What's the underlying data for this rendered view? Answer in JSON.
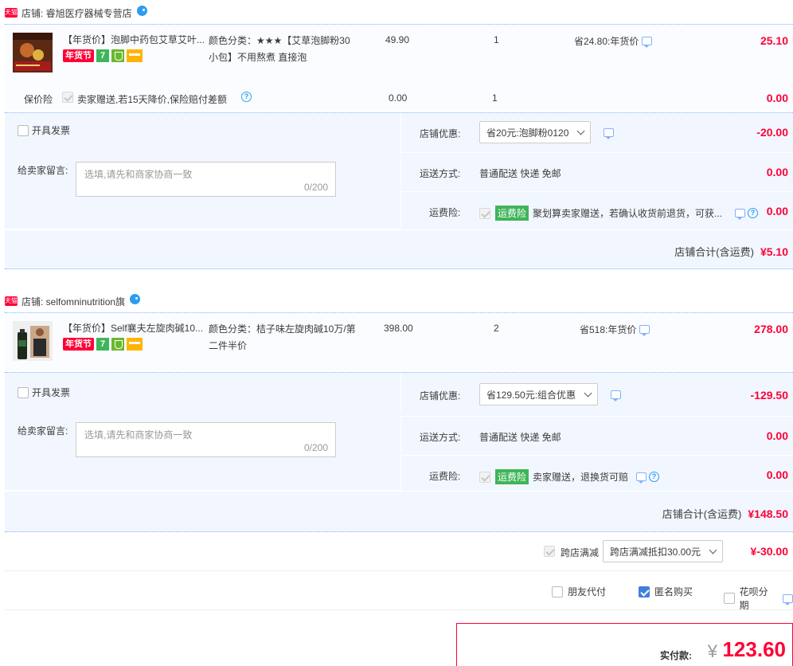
{
  "shops": [
    {
      "tmall_logo": "天猫",
      "name": "店铺: 睿旭医疗器械专营店",
      "item": {
        "title": "【年货价】泡脚中药包艾草艾叶...",
        "badge_festival": "年货节",
        "badge_seven": "7",
        "sku": "颜色分类：★★★【艾草泡脚粉30小包】不用熬煮 直接泡",
        "price": "49.90",
        "qty": "1",
        "promo": "省24.80:年货价",
        "subtotal": "25.10"
      },
      "insurance": {
        "label": "保价险",
        "desc": "卖家赠送,若15天降价,保险赔付差额",
        "price": "0.00",
        "qty": "1",
        "subtotal": "0.00"
      },
      "invoice_label": "开具发票",
      "memo_label": "给卖家留言:",
      "memo_placeholder": "选填,请先和商家协商一致",
      "memo_count": "0/200",
      "discount_label": "店铺优惠:",
      "discount_select": "省20元:泡脚粉0120",
      "discount_amount": "-20.00",
      "ship_label": "运送方式:",
      "ship_value": "普通配送 快递 免邮",
      "ship_amount": "0.00",
      "freight_ins_label": "运费险:",
      "freight_ins_tag": "运费险",
      "freight_ins_desc": "聚划算卖家赠送，若确认收货前退货，可获...",
      "freight_ins_amount": "0.00",
      "total_label": "店铺合计(含运费)",
      "total_amount": "¥5.10"
    },
    {
      "tmall_logo": "天猫",
      "name": "店铺: selfomninutrition旗",
      "item": {
        "title": "【年货价】Self襄夫左旋肉碱10...",
        "badge_festival": "年货节",
        "badge_seven": "7",
        "sku": "颜色分类：桔子味左旋肉碱10万/第二件半价",
        "price": "398.00",
        "qty": "2",
        "promo": "省518:年货价",
        "subtotal": "278.00"
      },
      "invoice_label": "开具发票",
      "memo_label": "给卖家留言:",
      "memo_placeholder": "选填,请先和商家协商一致",
      "memo_count": "0/200",
      "discount_label": "店铺优惠:",
      "discount_select": "省129.50元:组合优惠",
      "discount_amount": "-129.50",
      "ship_label": "运送方式:",
      "ship_value": "普通配送 快递 免邮",
      "ship_amount": "0.00",
      "freight_ins_label": "运费险:",
      "freight_ins_tag": "运费险",
      "freight_ins_desc": "卖家赠送，退换货可赔",
      "freight_ins_amount": "0.00",
      "total_label": "店铺合计(含运费)",
      "total_amount": "¥148.50"
    }
  ],
  "cross_store": {
    "label": "跨店满减",
    "select": "跨店满减抵扣30.00元",
    "amount": "¥-30.00"
  },
  "pay_options": {
    "friend_pay": "朋友代付",
    "anonymous": "匿名购买",
    "huabei": "花呗分期"
  },
  "final": {
    "label": "实付款:",
    "yen": "¥",
    "amount": "123.60"
  },
  "colors": {
    "accent_red": "#ff0036",
    "link_blue": "#2d9df0",
    "block_bg": "#f2f7ff",
    "green": "#3fb559"
  }
}
